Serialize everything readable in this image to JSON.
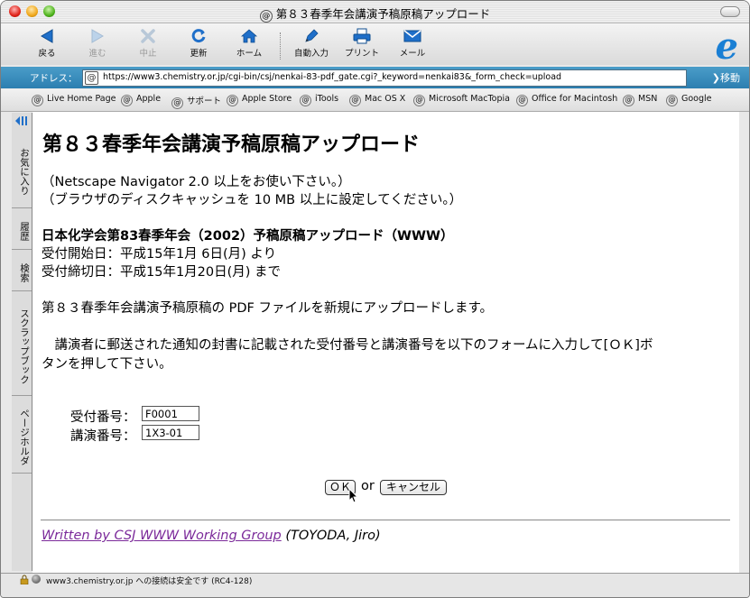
{
  "window": {
    "title": "第８３春季年会講演予稿原稿アップロード"
  },
  "toolbar": {
    "back": "戻る",
    "forward": "進む",
    "stop": "中止",
    "refresh": "更新",
    "home": "ホーム",
    "autofill": "自動入力",
    "print": "プリント",
    "mail": "メール"
  },
  "address": {
    "label": "アドレス：",
    "url": "https://www3.chemistry.or.jp/cgi-bin/csj/nenkai-83-pdf_gate.cgi?_keyword=nenkai83&_form_check=upload",
    "go": "移動"
  },
  "favorites": [
    "Live Home Page",
    "Apple",
    "サポート",
    "Apple Store",
    "iTools",
    "Mac OS X",
    "Microsoft MacTopia",
    "Office for Macintosh",
    "MSN",
    "Google"
  ],
  "sidebar": {
    "tabs": [
      "お気に入り",
      "履歴",
      "検索",
      "スクラップブック",
      "ページホルダ"
    ]
  },
  "page": {
    "heading": "第８３春季年会講演予稿原稿アップロード",
    "note1": "（Netscape Navigator 2.0 以上をお使い下さい。）",
    "note2": "（ブラウザのディスクキャッシュを 10 MB 以上に設定してください。）",
    "subheading": "日本化学会第83春季年会（2002）予稿原稿アップロード（WWW）",
    "start": "受付開始日：平成15年1月 6日(月) より",
    "end": "受付締切日：平成15年1月20日(月) まで",
    "desc": "第８３春季年会講演予稿原稿の PDF ファイルを新規にアップロードします。",
    "instr1": "　講演者に郵送された通知の封書に記載された受付番号と講演番号を以下のフォームに入力して[ＯＫ]ボ",
    "instr2": "タンを押して下さい。",
    "form": {
      "receipt_label": "受付番号：",
      "receipt_value": "F0001",
      "lecture_label": "講演番号：",
      "lecture_value": "1X3-01",
      "ok": "ＯＫ",
      "or": "or",
      "cancel": "キャンセル"
    },
    "footer_link": "Written by CSJ WWW Working Group",
    "footer_rest": " (TOYODA, Jiro)"
  },
  "status": {
    "text": "www3.chemistry.or.jp への接続は安全です (RC4-128)"
  },
  "colors": {
    "address_bar": "#2c7eb0",
    "link_visited": "#7b2a9a",
    "ie_blue": "#1a7fd4"
  }
}
